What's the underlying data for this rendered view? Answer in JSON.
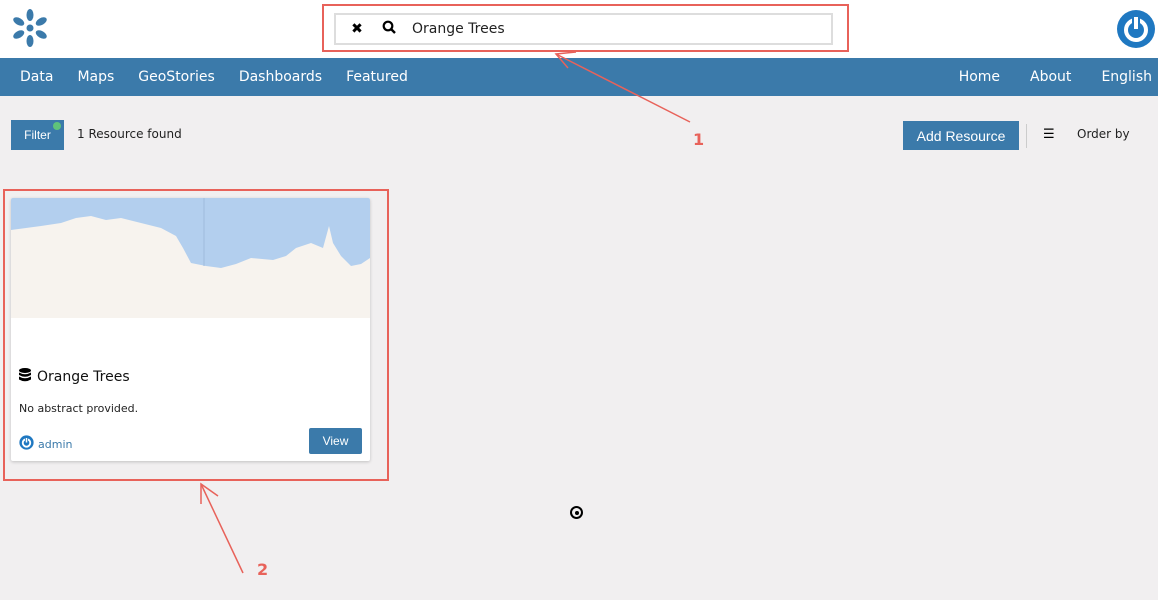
{
  "header": {
    "search_value": "Orange Trees",
    "clear_icon": "close-icon",
    "search_icon": "search-icon"
  },
  "nav": {
    "left": [
      "Data",
      "Maps",
      "GeoStories",
      "Dashboards",
      "Featured"
    ],
    "right": [
      "Home",
      "About",
      "English"
    ]
  },
  "toolbar": {
    "filter_label": "Filter",
    "result_count": "1 Resource found",
    "add_resource_label": "Add Resource",
    "order_label": "Order by"
  },
  "card": {
    "title": "Orange Trees",
    "abstract": "No abstract provided.",
    "owner": "admin",
    "view_label": "View",
    "type_icon": "database-icon"
  },
  "annotations": {
    "one": "1",
    "two": "2"
  },
  "colors": {
    "brand": "#3b7aaa",
    "annotation": "#e8625a",
    "filter_dot": "#5fc37a"
  }
}
